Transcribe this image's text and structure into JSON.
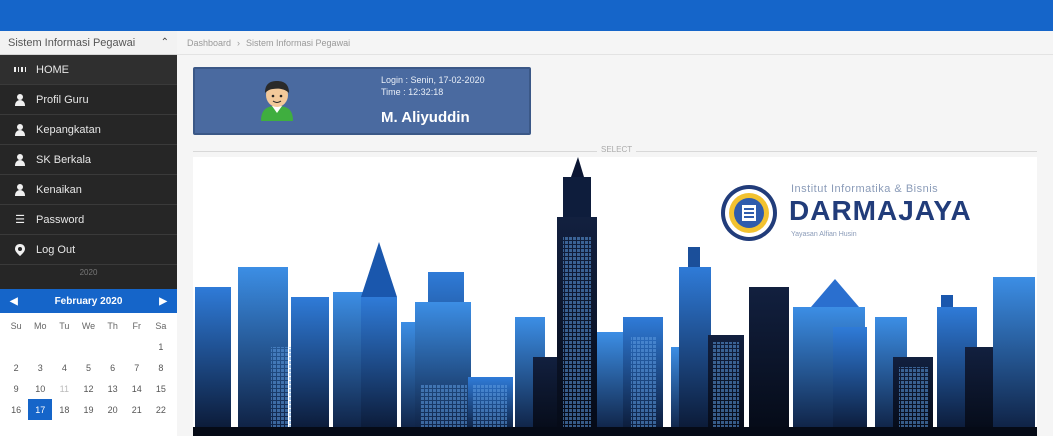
{
  "sidebar": {
    "title": "Sistem Informasi Pegawai",
    "items": [
      {
        "label": "HOME",
        "icon": "grid-icon"
      },
      {
        "label": "Profil Guru",
        "icon": "user-icon"
      },
      {
        "label": "Kepangkatan",
        "icon": "user-icon"
      },
      {
        "label": "SK Berkala",
        "icon": "user-icon"
      },
      {
        "label": "Kenaikan",
        "icon": "user-icon"
      },
      {
        "label": "Password",
        "icon": "list-icon"
      },
      {
        "label": "Log Out",
        "icon": "map-marker-icon"
      }
    ],
    "divider_label": "2020"
  },
  "calendar": {
    "month": "February 2020",
    "days_of_week": [
      "Su",
      "Mo",
      "Tu",
      "We",
      "Th",
      "Fr",
      "Sa"
    ],
    "weeks": [
      [
        "",
        "",
        "",
        "",
        "",
        "",
        "1"
      ],
      [
        "2",
        "3",
        "4",
        "5",
        "6",
        "7",
        "8"
      ],
      [
        "9",
        "10",
        "11",
        "12",
        "13",
        "14",
        "15"
      ],
      [
        "16",
        "17",
        "18",
        "19",
        "20",
        "21",
        "22"
      ]
    ],
    "today": "17"
  },
  "breadcrumb": {
    "home": "Dashboard",
    "current": "Sistem Informasi Pegawai"
  },
  "info": {
    "login": "Login : Senin, 17-02-2020",
    "time": "Time : 12:32:18",
    "name": "M. Aliyuddin"
  },
  "separator_label": "SELECT",
  "logo": {
    "top": "Institut Informatika & Bisnis",
    "main": "DARMAJAYA",
    "sub": "Yayasan Alfian Husin"
  },
  "colors": {
    "topbar": "#1565c9",
    "sidebar": "#262626",
    "info_box": "#4a6aa0",
    "logo_main": "#213c7a"
  }
}
